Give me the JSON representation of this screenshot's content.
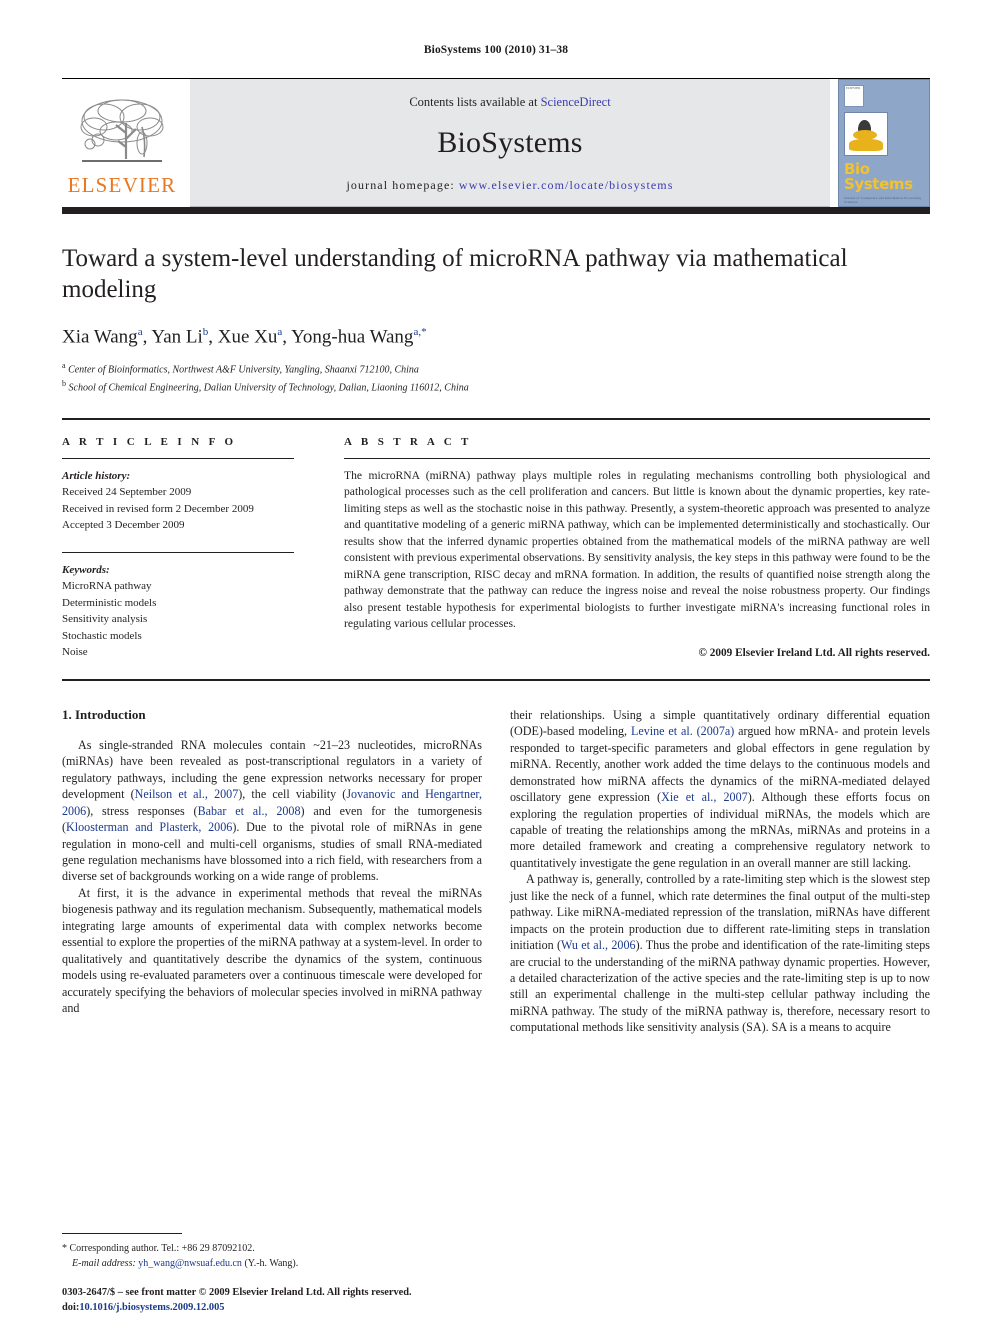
{
  "running_head": "BioSystems 100 (2010) 31–38",
  "masthead": {
    "publisher_name": "ELSEVIER",
    "contents_prefix": "Contents lists available at ",
    "contents_link": "ScienceDirect",
    "journal_name": "BioSystems",
    "homepage_label": "journal homepage:",
    "homepage_url": "www.elsevier.com/locate/biosystems",
    "cover_title": "Bio Systems",
    "cover_subtitle": "Journal of Computers and Information Processing Sciences",
    "cover_mark": "ELSEVIER"
  },
  "article": {
    "title": "Toward a system-level understanding of microRNA pathway via mathematical modeling",
    "authors_html": "Xia Wang<sup>a</sup>, Yan Li<sup>b</sup>, Xue Xu<sup>a</sup>, Yong-hua Wang<sup>a,*</sup>",
    "affiliation_a": "Center of Bioinformatics, Northwest A&F University, Yangling, Shaanxi 712100, China",
    "affiliation_b": "School of Chemical Engineering, Dalian University of Technology, Dalian, Liaoning 116012, China",
    "affiliation_a_marker": "a",
    "affiliation_b_marker": "b"
  },
  "article_info": {
    "heading": "A R T I C L E   I N F O",
    "history_label": "Article history:",
    "history": [
      "Received 24 September 2009",
      "Received in revised form 2 December 2009",
      "Accepted 3 December 2009"
    ],
    "keywords_label": "Keywords:",
    "keywords": [
      "MicroRNA pathway",
      "Deterministic models",
      "Sensitivity analysis",
      "Stochastic models",
      "Noise"
    ]
  },
  "abstract": {
    "heading": "A B S T R A C T",
    "text": "The microRNA (miRNA) pathway plays multiple roles in regulating mechanisms controlling both physiological and pathological processes such as the cell proliferation and cancers. But little is known about the dynamic properties, key rate-limiting steps as well as the stochastic noise in this pathway. Presently, a system-theoretic approach was presented to analyze and quantitative modeling of a generic miRNA pathway, which can be implemented deterministically and stochastically. Our results show that the inferred dynamic properties obtained from the mathematical models of the miRNA pathway are well consistent with previous experimental observations. By sensitivity analysis, the key steps in this pathway were found to be the miRNA gene transcription, RISC decay and mRNA formation. In addition, the results of quantified noise strength along the pathway demonstrate that the pathway can reduce the ingress noise and reveal the noise robustness property. Our findings also present testable hypothesis for experimental biologists to further investigate miRNA's increasing functional roles in regulating various cellular processes.",
    "copyright": "© 2009 Elsevier Ireland Ltd. All rights reserved."
  },
  "body": {
    "section_heading": "1.  Introduction",
    "left_paragraph_1_parts": {
      "p1": "As single-stranded RNA molecules contain ~21–23 nucleotides, microRNAs (miRNAs) have been revealed as post-transcriptional regulators in a variety of regulatory pathways, including the gene expression networks necessary for proper development (",
      "c1": "Neilson et al., 2007",
      "p2": "), the cell viability (",
      "c2": "Jovanovic and Hengartner, 2006",
      "p3": "), stress responses (",
      "c3": "Babar et al., 2008",
      "p4": ") and even for the tumorgenesis (",
      "c4": "Kloosterman and Plasterk, 2006",
      "p5": "). Due to the pivotal role of miRNAs in gene regulation in mono-cell and multi-cell organisms, studies of small RNA-mediated gene regulation mechanisms have blossomed into a rich field, with researchers from a diverse set of backgrounds working on a wide range of problems."
    },
    "left_paragraph_2": "At first, it is the advance in experimental methods that reveal the miRNAs biogenesis pathway and its regulation mechanism. Subsequently, mathematical models integrating large amounts of experimental data with complex networks become essential to explore the properties of the miRNA pathway at a system-level. In order to qualitatively and quantitatively describe the dynamics of the system, continuous models using re-evaluated parameters over a continuous timescale were developed for accurately specifying the behaviors of molecular species involved in miRNA pathway and",
    "right_paragraph_1_parts": {
      "p1": "their relationships. Using a simple quantitatively ordinary differential equation (ODE)-based modeling, ",
      "c1": "Levine et al. (2007a)",
      "p2": " argued how mRNA- and protein levels responded to target-specific parameters and global effectors in gene regulation by miRNA. Recently, another work added the time delays to the continuous models and demonstrated how miRNA affects the dynamics of the miRNA-mediated delayed oscillatory gene expression (",
      "c2": "Xie et al., 2007",
      "p3": "). Although these efforts focus on exploring the regulation properties of individual miRNAs, the models which are capable of treating the relationships among the mRNAs, miRNAs and proteins in a more detailed framework and creating a comprehensive regulatory network to quantitatively investigate the gene regulation in an overall manner are still lacking."
    },
    "right_paragraph_2_parts": {
      "p1": "A pathway is, generally, controlled by a rate-limiting step which is the slowest step just like the neck of a funnel, which rate determines the final output of the multi-step pathway. Like miRNA-mediated repression of the translation, miRNAs have different impacts on the protein production due to different rate-limiting steps in translation initiation (",
      "c1": "Wu et al., 2006",
      "p2": "). Thus the probe and identification of the rate-limiting steps are crucial to the understanding of the miRNA pathway dynamic properties. However, a detailed characterization of the active species and the rate-limiting step is up to now still an experimental challenge in the multi-step cellular pathway including the miRNA pathway. The study of the miRNA pathway is, therefore, necessary resort to computational methods like sensitivity analysis (SA). SA is a means to acquire"
    }
  },
  "footnotes": {
    "corresponding_marker": "*",
    "corresponding_text": "Corresponding author. Tel.: +86 29 87092102.",
    "email_label": "E-mail address:",
    "email": "yh_wang@nwsuaf.edu.cn",
    "email_suffix": "(Y.-h. Wang)."
  },
  "imprint": {
    "issn_line": "0303-2647/$ – see front matter © 2009 Elsevier Ireland Ltd. All rights reserved.",
    "doi_prefix": "doi:",
    "doi": "10.1016/j.biosystems.2009.12.005"
  },
  "colors": {
    "link_blue": "#1b3a8c",
    "sciencedirect_blue": "#3b3bb0",
    "elsevier_orange": "#e87722",
    "banner_gray": "#e6e7e8",
    "cover_blue": "#8ea6c8",
    "rule_black": "#231f20"
  }
}
